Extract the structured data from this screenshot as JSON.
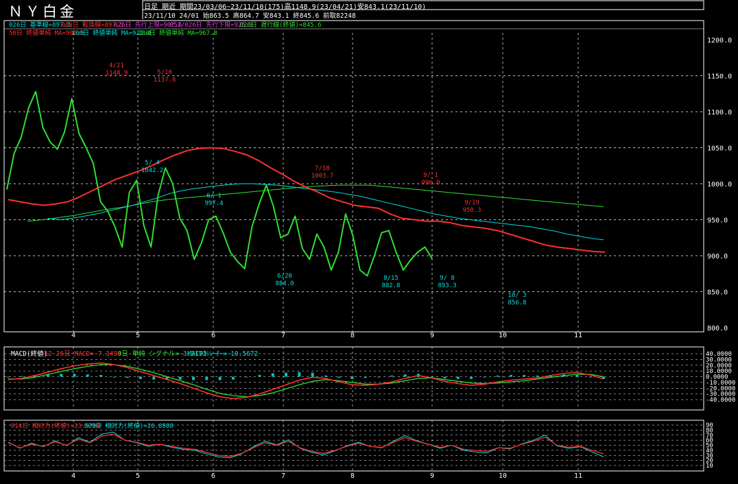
{
  "header": {
    "title": "ＮＹ白金",
    "info_line1": "日足 期近 期間23/03/06~23/11/10(175)高1148.9(23/04/21)安843.1(23/11/10)",
    "info_line2": "23/11/10 24/01 始863.5 高864.7 安843.1 終845.6 前取82248"
  },
  "legend_line1": [
    {
      "text": "026日 基準線=897.5",
      "color": "#00e0e0"
    },
    {
      "text": "009日 転換線=897.5",
      "color": "#ff3030"
    },
    {
      "text": "026日 先行上限=907.6",
      "color": "#e040e0"
    },
    {
      "text": "052/026日 先行下限=925.9",
      "color": "#e040e0"
    },
    {
      "text": "026日 遅行線(終値)=845.6",
      "color": "#30e030"
    }
  ],
  "legend_line2": [
    {
      "text": "50日 終値単純 MA=906.5",
      "color": "#ff3030"
    },
    {
      "text": "100日 終値単純 MA=922.4",
      "color": "#00e0e0"
    },
    {
      "text": "200日 終値単純 MA=967.8",
      "color": "#30e030"
    }
  ],
  "macd_legend": [
    {
      "text": "MACD(終値)",
      "color": "#ffffff"
    },
    {
      "text": "12-26日 MACD=-7.3498",
      "color": "#ff3030"
    },
    {
      "text": "9日 単純 シグナル=-3.2173",
      "color": "#30e030"
    },
    {
      "text": "MACDｵｼﾚｰﾀｰ=-10.5672",
      "color": "#00e0e0"
    }
  ],
  "rsi_legend": [
    {
      "text": "014日 相対力(終値)=33.5784",
      "color": "#ff3030"
    },
    {
      "text": "009日 相対力(終値)=26.8988",
      "color": "#00e0e0"
    }
  ],
  "annotations": [
    {
      "date": "4/21",
      "value": "1148.9",
      "color": "#ff3030"
    },
    {
      "date": "5/10",
      "value": "1137.8",
      "color": "#ff3030"
    },
    {
      "date": "5/ 4",
      "value": "1042.2",
      "color": "#00e0e0"
    },
    {
      "date": "7/18",
      "value": "1003.7",
      "color": "#ff3030"
    },
    {
      "date": "9/ 1",
      "value": "996.0",
      "color": "#ff3030"
    },
    {
      "date": "6/20",
      "value": "884.0",
      "color": "#00e0e0"
    },
    {
      "date": "8/15",
      "value": "882.8",
      "color": "#00e0e0"
    },
    {
      "date": "9/ 8",
      "value": "893.3",
      "color": "#00e0e0"
    },
    {
      "date": "10/ 3",
      "value": "856.8",
      "color": "#00e0e0"
    },
    {
      "date": "9/19",
      "value": "950.3",
      "color": "#ff3030"
    },
    {
      "date": "6/ 1",
      "value": "997.4",
      "color": "#00e0e0"
    }
  ],
  "chart_data": [
    {
      "type": "line",
      "title": "ＮＹ白金",
      "x_months": [
        "4",
        "5",
        "6",
        "7",
        "8",
        "9",
        "10",
        "11"
      ],
      "ylim": [
        800,
        1200
      ],
      "yticks": [
        "800.0",
        "850.0",
        "900.0",
        "950.0",
        "1000.0",
        "1050.0",
        "1100.0",
        "1150.0",
        "1200.0"
      ],
      "grid": true,
      "series": [
        {
          "name": "026日 遅行線(終値)",
          "color": "#30e030",
          "values": [
            992,
            1042,
            1065,
            1105,
            1128,
            1078,
            1058,
            1048,
            1072,
            1118,
            1070,
            1050,
            1028,
            975,
            962,
            940,
            912,
            988,
            1005,
            942,
            912,
            985,
            1022,
            1000,
            952,
            935,
            895,
            918,
            950,
            955,
            932,
            905,
            892,
            882,
            940,
            972,
            998,
            968,
            925,
            930,
            955,
            910,
            895,
            930,
            912,
            880,
            905,
            958,
            928,
            880,
            872,
            900,
            932,
            935,
            905,
            880,
            894,
            905,
            912,
            896
          ]
        },
        {
          "name": "50日 終値単純 MA",
          "color": "#ff3030",
          "values": [
            978,
            975,
            972,
            970,
            972,
            975,
            982,
            990,
            998,
            1006,
            1012,
            1018,
            1025,
            1033,
            1040,
            1046,
            1049,
            1050,
            1049,
            1045,
            1040,
            1032,
            1022,
            1013,
            1003,
            995,
            988,
            980,
            975,
            970,
            968,
            966,
            958,
            952,
            950,
            948,
            948,
            946,
            942,
            940,
            938,
            935,
            930,
            925,
            920,
            915,
            912,
            910,
            908,
            906,
            905
          ]
        },
        {
          "name": "100日 終値単純 MA",
          "color": "#00e0e0",
          "values": [
            952,
            950,
            952,
            955,
            958,
            962,
            966,
            970,
            975,
            980,
            986,
            990,
            993,
            995,
            997,
            999,
            1000,
            1000,
            999,
            998,
            996,
            994,
            992,
            990,
            988,
            985,
            982,
            978,
            974,
            970,
            966,
            962,
            958,
            955,
            952,
            950,
            948,
            946,
            944,
            942,
            940,
            937,
            934,
            930,
            927,
            924,
            922
          ]
        },
        {
          "name": "200日 終値単純 MA",
          "color": "#30e030",
          "values": [
            948,
            950,
            953,
            956,
            960,
            964,
            967,
            971,
            975,
            978,
            980,
            982,
            984,
            986,
            988,
            990,
            992,
            994,
            996,
            997,
            998,
            998,
            998,
            996,
            994,
            992,
            990,
            988,
            986,
            984,
            982,
            980,
            978,
            976,
            974,
            972,
            970,
            968
          ]
        }
      ]
    },
    {
      "type": "line",
      "title": "MACD(終値)",
      "ylim": [
        -40,
        40
      ],
      "yticks": [
        "40.0000",
        "30.0000",
        "20.0000",
        "10.0000",
        "0.0000",
        "-10.0000",
        "-20.0000",
        "-30.0000",
        "-40.0000"
      ],
      "series": [
        {
          "name": "12-26日 MACD",
          "color": "#ff3030",
          "values": [
            -5,
            -3,
            2,
            8,
            14,
            19,
            22,
            24,
            21,
            16,
            9,
            2,
            -5,
            -12,
            -20,
            -28,
            -35,
            -38,
            -36,
            -30,
            -22,
            -14,
            -6,
            -1,
            -3,
            -9,
            -14,
            -15,
            -13,
            -9,
            -3,
            2,
            -2,
            -8,
            -12,
            -15,
            -13,
            -9,
            -6,
            -4,
            -2,
            2,
            6,
            7,
            3,
            -4
          ]
        },
        {
          "name": "9日 単純 シグナル",
          "color": "#30e030",
          "values": [
            -4,
            -4,
            -1,
            4,
            9,
            14,
            18,
            21,
            21,
            18,
            13,
            7,
            0,
            -7,
            -14,
            -22,
            -29,
            -33,
            -35,
            -33,
            -28,
            -21,
            -14,
            -8,
            -5,
            -7,
            -10,
            -13,
            -13,
            -11,
            -7,
            -3,
            -2,
            -5,
            -8,
            -11,
            -12,
            -11,
            -9,
            -7,
            -4,
            -1,
            2,
            4,
            4,
            0
          ]
        },
        {
          "name": "MACDｵｼﾚｰﾀｰ",
          "color": "#00e0e0",
          "values": [
            -1,
            1,
            3,
            4,
            5,
            5,
            4,
            3,
            0,
            -2,
            -4,
            -5,
            -5,
            -5,
            -6,
            -6,
            -6,
            -5,
            -1,
            3,
            6,
            7,
            8,
            7,
            2,
            -2,
            -4,
            -2,
            0,
            2,
            4,
            5,
            0,
            -3,
            -4,
            -4,
            -1,
            2,
            3,
            3,
            2,
            3,
            4,
            3,
            -1,
            -4
          ]
        }
      ]
    },
    {
      "type": "line",
      "title": "相対力(終値)",
      "ylim": [
        10,
        90
      ],
      "yticks": [
        "90",
        "80",
        "70",
        "60",
        "50",
        "40",
        "30",
        "20",
        "10"
      ],
      "series": [
        {
          "name": "014日 相対力(終値)",
          "color": "#ff3030",
          "values": [
            55,
            45,
            52,
            48,
            57,
            50,
            62,
            55,
            68,
            72,
            60,
            56,
            50,
            52,
            48,
            44,
            42,
            36,
            30,
            28,
            34,
            45,
            55,
            50,
            58,
            45,
            38,
            34,
            40,
            48,
            54,
            48,
            46,
            56,
            65,
            58,
            52,
            46,
            50,
            42,
            40,
            38,
            45,
            44,
            52,
            58,
            66,
            50,
            46,
            48,
            40,
            33
          ]
        },
        {
          "name": "009日 相対力(終値)",
          "color": "#00e0e0",
          "values": [
            56,
            44,
            54,
            47,
            59,
            49,
            65,
            56,
            72,
            76,
            60,
            55,
            48,
            52,
            46,
            42,
            40,
            33,
            27,
            25,
            33,
            47,
            58,
            51,
            61,
            44,
            36,
            31,
            39,
            49,
            56,
            48,
            45,
            58,
            69,
            59,
            52,
            44,
            50,
            40,
            37,
            35,
            45,
            43,
            53,
            60,
            70,
            49,
            44,
            47,
            37,
            27
          ]
        }
      ]
    }
  ]
}
